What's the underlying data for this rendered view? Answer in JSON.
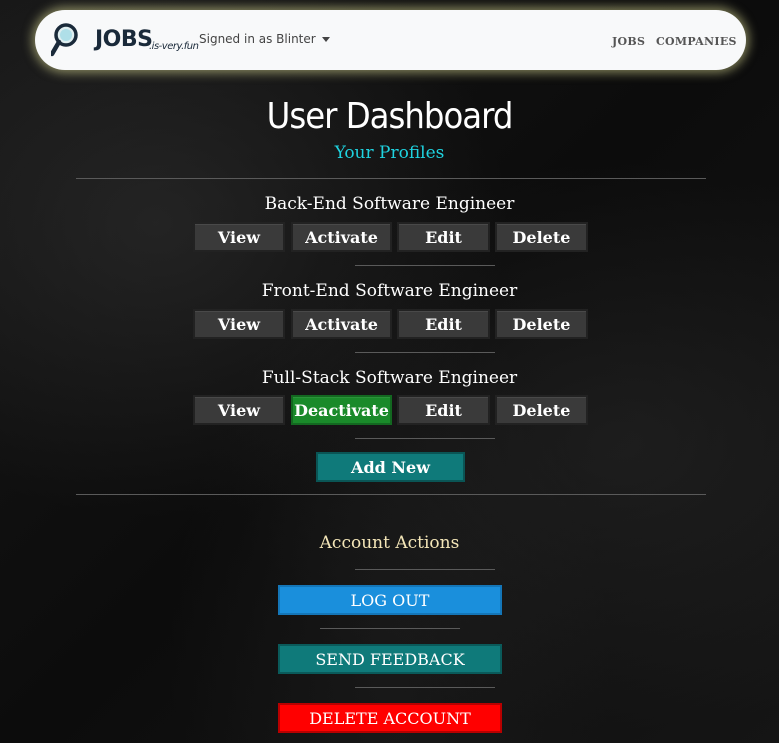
{
  "nav": {
    "logo_main": "JOBS",
    "logo_sub": ".is-very.fun",
    "signed_in": "Signed in as Blinter",
    "links": [
      "JOBS",
      "COMPANIES"
    ]
  },
  "page": {
    "title": "User Dashboard",
    "subtitle": "Your Profiles"
  },
  "profiles": [
    {
      "name": "Back-End Software Engineer",
      "view": "View",
      "toggle": "Activate",
      "edit": "Edit",
      "delete": "Delete"
    },
    {
      "name": "Front-End Software Engineer",
      "view": "View",
      "toggle": "Activate",
      "edit": "Edit",
      "delete": "Delete"
    },
    {
      "name": "Full-Stack Software Engineer",
      "view": "View",
      "toggle": "Deactivate",
      "edit": "Edit",
      "delete": "Delete"
    }
  ],
  "add_new": "Add New",
  "account": {
    "heading": "Account Actions",
    "logout": "LOG OUT",
    "feedback": "SEND FEEDBACK",
    "delete": "DELETE ACCOUNT"
  },
  "colors": {
    "accent_cyan": "#1fd3e0",
    "deactivate_green": "#1a8a2a",
    "teal": "#0f7a7a",
    "logout_blue": "#1a8fdc",
    "danger_red": "#ff0000"
  },
  "icons": {
    "logo": "magnifier-icon",
    "dropdown": "caret-down-icon"
  }
}
